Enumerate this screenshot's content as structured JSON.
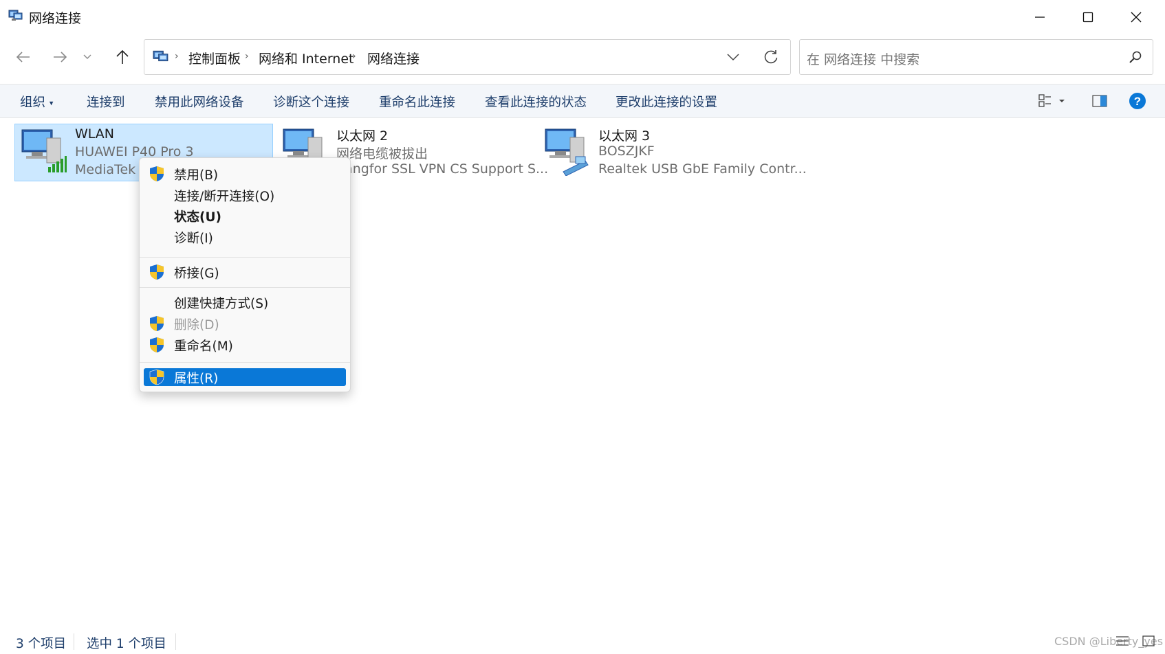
{
  "window": {
    "title": "网络连接"
  },
  "breadcrumb": [
    "控制面板",
    "网络和 Internet",
    "网络连接"
  ],
  "search": {
    "placeholder": "在 网络连接 中搜索"
  },
  "toolbar": {
    "organize": "组织",
    "commands": [
      "连接到",
      "禁用此网络设备",
      "诊断这个连接",
      "重命名此连接",
      "查看此连接的状态",
      "更改此连接的设置"
    ]
  },
  "items": [
    {
      "name": "WLAN",
      "line2": "HUAWEI P40 Pro 3",
      "line3": "MediaTek W",
      "icon": "wifi-adapter-icon",
      "selected": true
    },
    {
      "name": "以太网 2",
      "line2": "网络电缆被拔出",
      "line3": "Sangfor SSL VPN CS Support S...",
      "icon": "ethernet-disconnected-icon"
    },
    {
      "name": "以太网 3",
      "line2": "BOSZJKF",
      "line3": "Realtek USB GbE Family Contr...",
      "icon": "ethernet-adapter-icon"
    }
  ],
  "context_menu": {
    "items": [
      {
        "label": "禁用(B)",
        "shield": true
      },
      {
        "label": "连接/断开连接(O)"
      },
      {
        "label": "状态(U)",
        "bold": true
      },
      {
        "label": "诊断(I)"
      },
      {
        "label": "桥接(G)",
        "shield": true
      },
      {
        "label": "创建快捷方式(S)"
      },
      {
        "label": "删除(D)",
        "shield": true,
        "disabled": true
      },
      {
        "label": "重命名(M)",
        "shield": true
      },
      {
        "label": "属性(R)",
        "shield": true,
        "highlighted": true
      }
    ]
  },
  "status": {
    "count": "3 个项目",
    "selected": "选中 1 个项目"
  },
  "watermark": "CSDN @Liberty_yes",
  "colors": {
    "accent": "#0a78d7",
    "selection": "#cce8ff",
    "command_text": "#1e3e6b"
  }
}
